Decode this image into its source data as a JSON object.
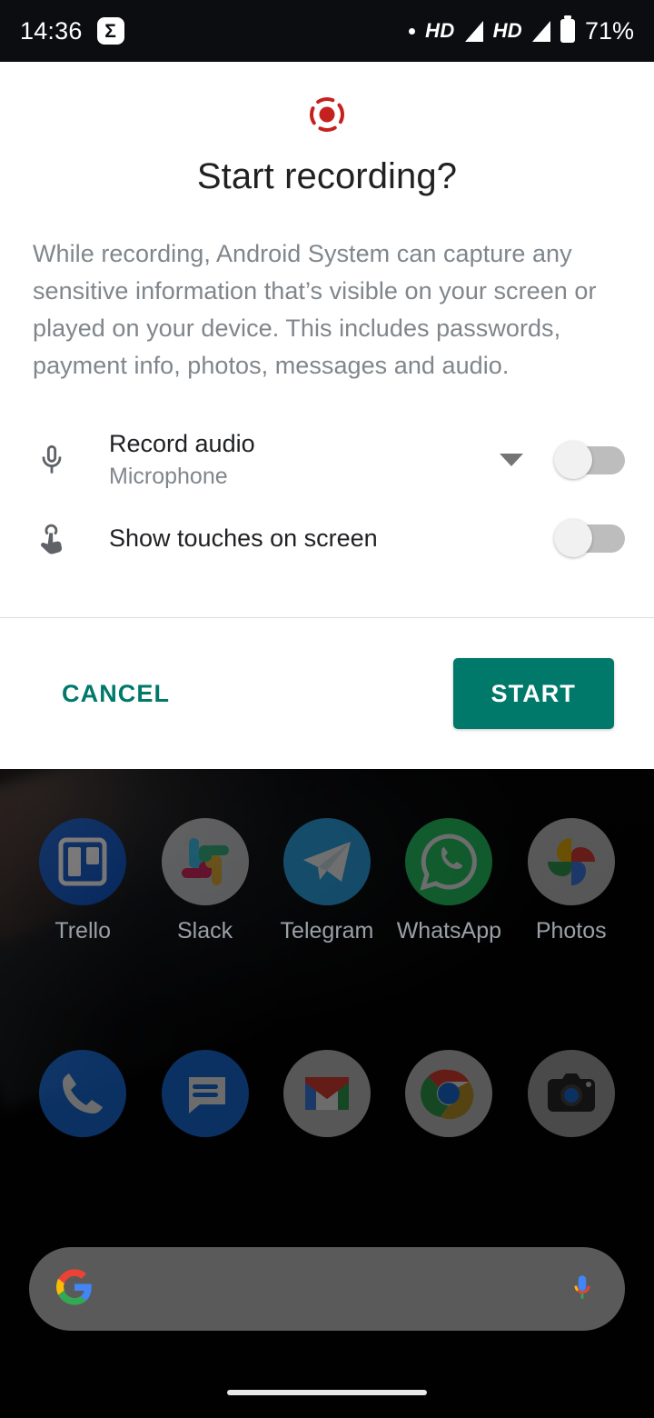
{
  "status_bar": {
    "time": "14:36",
    "notification_icon_glyph": "Σ",
    "notification_icon_name": "sigma-notification-icon",
    "indicator_dot": "•",
    "network_1_label": "HD",
    "network_2_label": "HD",
    "battery_percent": "71%",
    "background_color": "#0b0d11"
  },
  "dialog": {
    "icon_name": "screen-record-icon",
    "icon_color": "#c5221f",
    "title": "Start recording?",
    "body": "While recording, Android System can capture any sensitive information that’s visible on your screen or played on your device. This includes passwords, payment info, photos, messages and audio.",
    "options": [
      {
        "icon_name": "microphone-icon",
        "title": "Record audio",
        "subtitle": "Microphone",
        "has_dropdown": true,
        "dropdown_icon_name": "caret-down-icon",
        "toggle_state": "off"
      },
      {
        "icon_name": "touch-pointer-icon",
        "title": "Show touches on screen",
        "subtitle": "",
        "has_dropdown": false,
        "dropdown_icon_name": "",
        "toggle_state": "off"
      }
    ],
    "actions": {
      "cancel_label": "CANCEL",
      "start_label": "START",
      "accent_color": "#00796b"
    }
  },
  "home_screen": {
    "app_rows": [
      [
        {
          "label": "Trello",
          "icon_name": "trello-icon"
        },
        {
          "label": "Slack",
          "icon_name": "slack-icon"
        },
        {
          "label": "Telegram",
          "icon_name": "telegram-icon"
        },
        {
          "label": "WhatsApp",
          "icon_name": "whatsapp-icon"
        },
        {
          "label": "Photos",
          "icon_name": "google-photos-icon"
        }
      ],
      [
        {
          "label": "",
          "icon_name": "phone-icon"
        },
        {
          "label": "",
          "icon_name": "messages-icon"
        },
        {
          "label": "",
          "icon_name": "gmail-icon"
        },
        {
          "label": "",
          "icon_name": "chrome-icon"
        },
        {
          "label": "",
          "icon_name": "camera-icon"
        }
      ]
    ],
    "search": {
      "placeholder": "",
      "value": "",
      "logo_icon_name": "google-g-icon",
      "voice_icon_name": "microphone-voice-icon"
    },
    "nav_gesture_name": "home-gesture-pill"
  }
}
